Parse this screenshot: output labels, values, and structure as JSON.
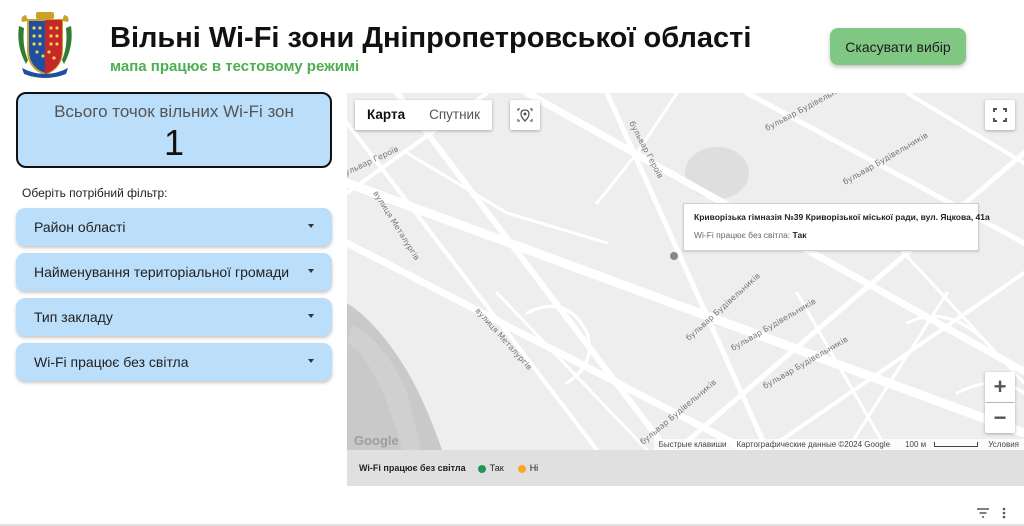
{
  "header": {
    "title": "Вільні Wi-Fi зони Дніпропетровської області",
    "subtitle": "мапа працює в тестовому режимі",
    "cancel_button": "Скасувати вибір"
  },
  "counter": {
    "label": "Всього точок вільних Wi-Fi зон",
    "value": "1"
  },
  "filters": {
    "label": "Оберіть потрібний фільтр:",
    "items": [
      {
        "label": "Район області"
      },
      {
        "label": "Найменування територіальної громади"
      },
      {
        "label": "Тип закладу"
      },
      {
        "label": "Wi-Fi працює без світла"
      }
    ]
  },
  "map": {
    "type_map": "Карта",
    "type_satellite": "Спутник",
    "streets": [
      "бульвар Героїв",
      "бульвар Героїв",
      "вулиця Металургів",
      "вулиця Металургів",
      "бульвар Будівельників",
      "бульвар Будівельників",
      "бульвар Будівельників",
      "бульвар Будівельників",
      "бульвар Будівельників",
      "бульвар Будівельників"
    ],
    "info": {
      "name": "Криворізька гімназія №39 Криворізької міської ради, вул. Яцкова, 41а",
      "wifi_label": "Wi-Fi працює без світла:",
      "wifi_value": "Так"
    },
    "zoom_in": "+",
    "zoom_out": "−",
    "google": "Google",
    "footer": {
      "shortcuts": "Быстрые клавиши",
      "attribution": "Картографические данные ©2024 Google",
      "scale": "100 м",
      "terms": "Условия"
    }
  },
  "legend": {
    "title": "Wi-Fi працює без світла",
    "items": [
      {
        "label": "Так",
        "color": "#1e9a54"
      },
      {
        "label": "Ні",
        "color": "#f9a825"
      }
    ]
  },
  "colors": {
    "accent_green": "#4caf50",
    "card_blue": "#bbdefb",
    "button_green": "#81c784"
  }
}
